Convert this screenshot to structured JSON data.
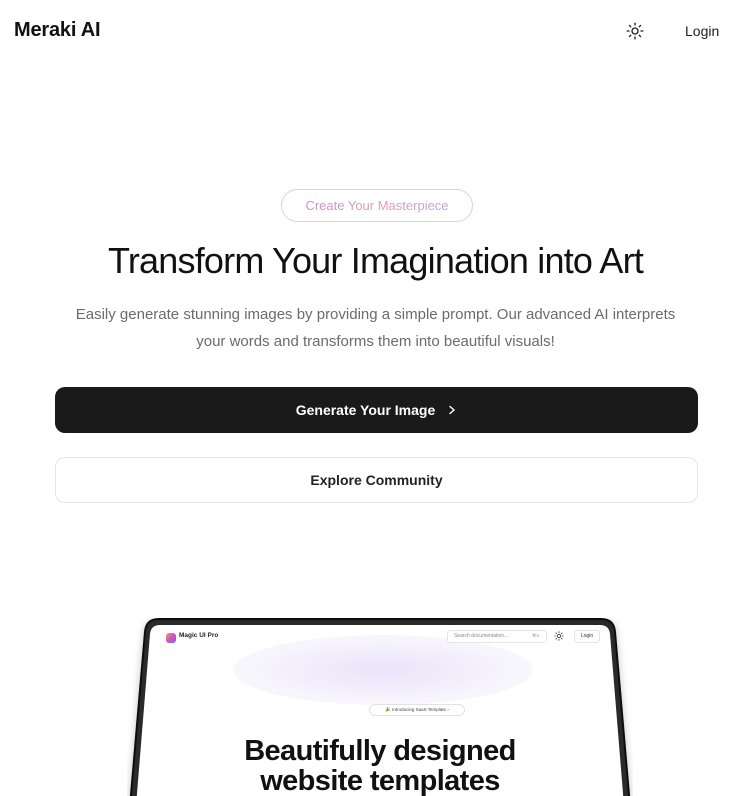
{
  "nav": {
    "brand": "Meraki AI",
    "theme_icon": "sun-icon",
    "login": "Login"
  },
  "hero": {
    "badge": "Create Your Masterpiece",
    "title": "Transform Your Imagination into Art",
    "description": "Easily generate stunning images by providing a simple prompt. Our advanced AI interprets your words and transforms them into beautiful visuals!",
    "primary_button": "Generate Your Image",
    "primary_button_icon": "chevron-right-icon",
    "secondary_button": "Explore Community"
  },
  "preview": {
    "brand": "Magic UI Pro",
    "search_placeholder": "Search documentation...",
    "shortcut": "⌘K",
    "theme_icon": "sun-icon",
    "login": "Login",
    "pill": "🎉 Introducing SaaS Template ›",
    "headline": "Beautifully designed website templates"
  },
  "colors": {
    "primary_button_bg": "#1a1a1a",
    "badge_gradient": [
      "#c98bd8",
      "#e39ab5",
      "#b9a3e0"
    ],
    "text_muted": "#6b6b6b"
  }
}
